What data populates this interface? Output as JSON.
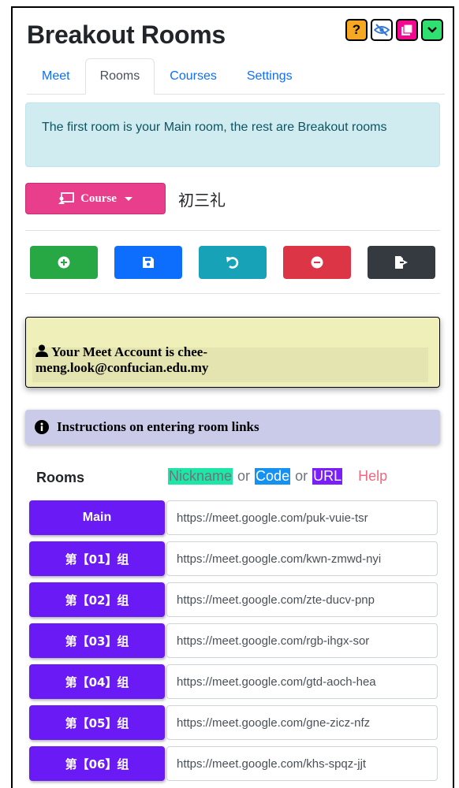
{
  "header": {
    "title": "Breakout Rooms",
    "help_label": "?",
    "icons": [
      "help-icon",
      "hide-eye-icon",
      "window-icon",
      "chevron-down-icon"
    ]
  },
  "tabs": [
    {
      "label": "Meet",
      "active": false
    },
    {
      "label": "Rooms",
      "active": true
    },
    {
      "label": "Courses",
      "active": false
    },
    {
      "label": "Settings",
      "active": false
    }
  ],
  "info_alert": "The first room is your Main room, the rest are Breakout rooms",
  "course": {
    "button_label": "Course",
    "selected_name": "初三礼"
  },
  "actions": [
    {
      "name": "add",
      "icon": "plus-circle-icon",
      "color": "#28a745"
    },
    {
      "name": "save",
      "icon": "floppy-disk-icon",
      "color": "#0d6efd"
    },
    {
      "name": "undo",
      "icon": "undo-icon",
      "color": "#17a2b8"
    },
    {
      "name": "remove",
      "icon": "minus-circle-icon",
      "color": "#dc3545"
    },
    {
      "name": "export",
      "icon": "file-export-icon",
      "color": "#343a40"
    }
  ],
  "account": {
    "text": "Your Meet Account is chee-meng.look@confucian.edu.my"
  },
  "instructions": {
    "label": "Instructions on entering room links"
  },
  "rooms_section": {
    "heading": "Rooms",
    "legend": {
      "nickname": "Nickname",
      "or1": "or",
      "code": "Code",
      "or2": "or",
      "url": "URL",
      "help": "Help"
    },
    "rooms": [
      {
        "label": "Main",
        "url": "https://meet.google.com/puk-vuie-tsr"
      },
      {
        "label": "第【01】组",
        "url": "https://meet.google.com/kwn-zmwd-nyi"
      },
      {
        "label": "第【02】组",
        "url": "https://meet.google.com/zte-ducv-pnp"
      },
      {
        "label": "第【03】组",
        "url": "https://meet.google.com/rgb-ihgx-sor"
      },
      {
        "label": "第【04】组",
        "url": "https://meet.google.com/gtd-aoch-hea"
      },
      {
        "label": "第【05】组",
        "url": "https://meet.google.com/gne-zicz-nfz"
      },
      {
        "label": "第【06】组",
        "url": "https://meet.google.com/khs-spqz-jjt"
      }
    ]
  }
}
